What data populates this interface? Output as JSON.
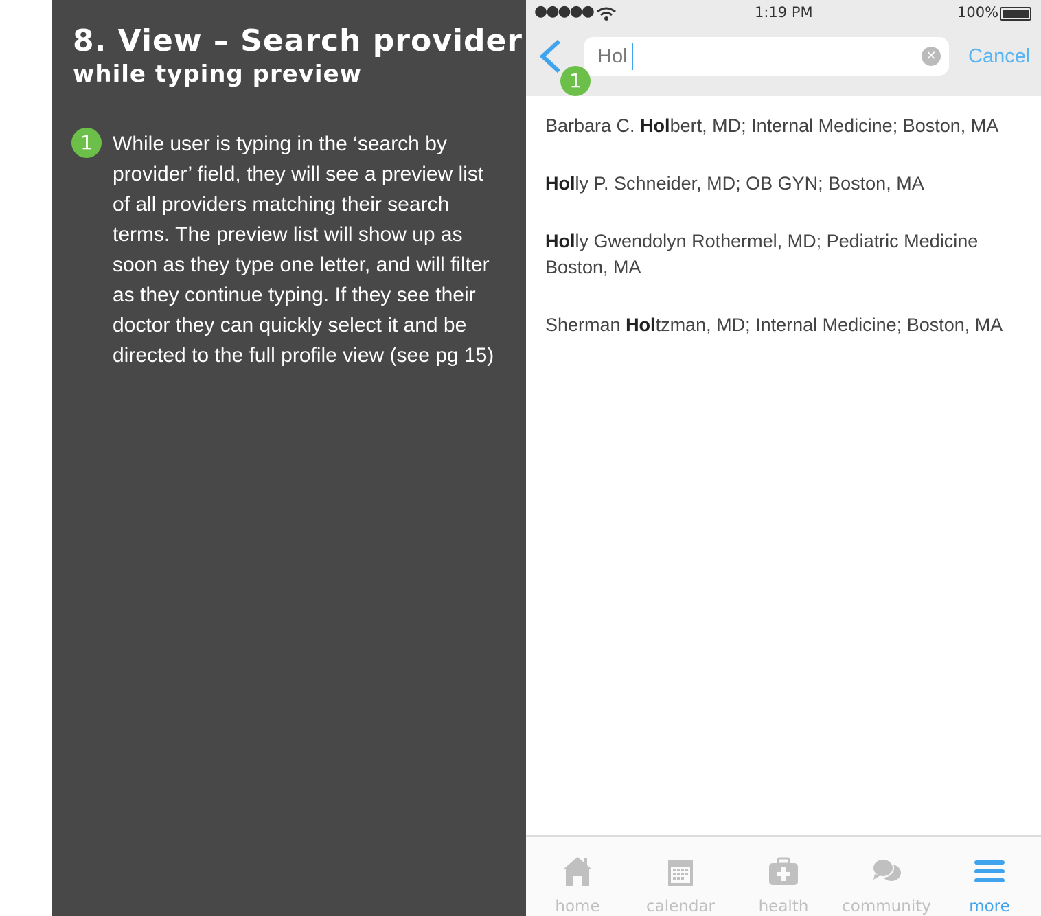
{
  "annotation": {
    "title": "8. View – Search provider",
    "subtitle": "while typing preview",
    "badge": "1",
    "description": "While user is typing in the ‘search by provider’ field, they will see a preview list of all providers matching their search terms. The preview list will show up as soon as they type one letter, and will filter as they continue typing. If they see their doctor they can quickly select it and be directed to the full profile view (see pg 15)"
  },
  "status_bar": {
    "time": "1:19 PM",
    "battery": "100%"
  },
  "search": {
    "value": "Hol",
    "cancel_label": "Cancel",
    "badge": "1"
  },
  "results": [
    {
      "pre": "Barbara C. ",
      "match": "Hol",
      "post": "bert, MD; Internal Medicine; Boston, MA"
    },
    {
      "pre": "",
      "match": "Hol",
      "post": "ly P. Schneider, MD; OB GYN; Boston, MA"
    },
    {
      "pre": "",
      "match": "Hol",
      "post": "ly Gwendolyn Rothermel, MD; Pediatric Medicine Boston, MA"
    },
    {
      "pre": "Sherman ",
      "match": "Hol",
      "post": "tzman, MD; Internal Medicine; Boston, MA"
    }
  ],
  "tabs": [
    {
      "label": "home",
      "icon": "home-icon"
    },
    {
      "label": "calendar",
      "icon": "calendar-icon"
    },
    {
      "label": "health",
      "icon": "health-kit-icon"
    },
    {
      "label": "community",
      "icon": "chat-bubbles-icon"
    },
    {
      "label": "more",
      "icon": "menu-icon",
      "active": true
    }
  ],
  "colors": {
    "accent": "#3fa3ee",
    "badge": "#6cc04a",
    "panel": "#484848"
  }
}
